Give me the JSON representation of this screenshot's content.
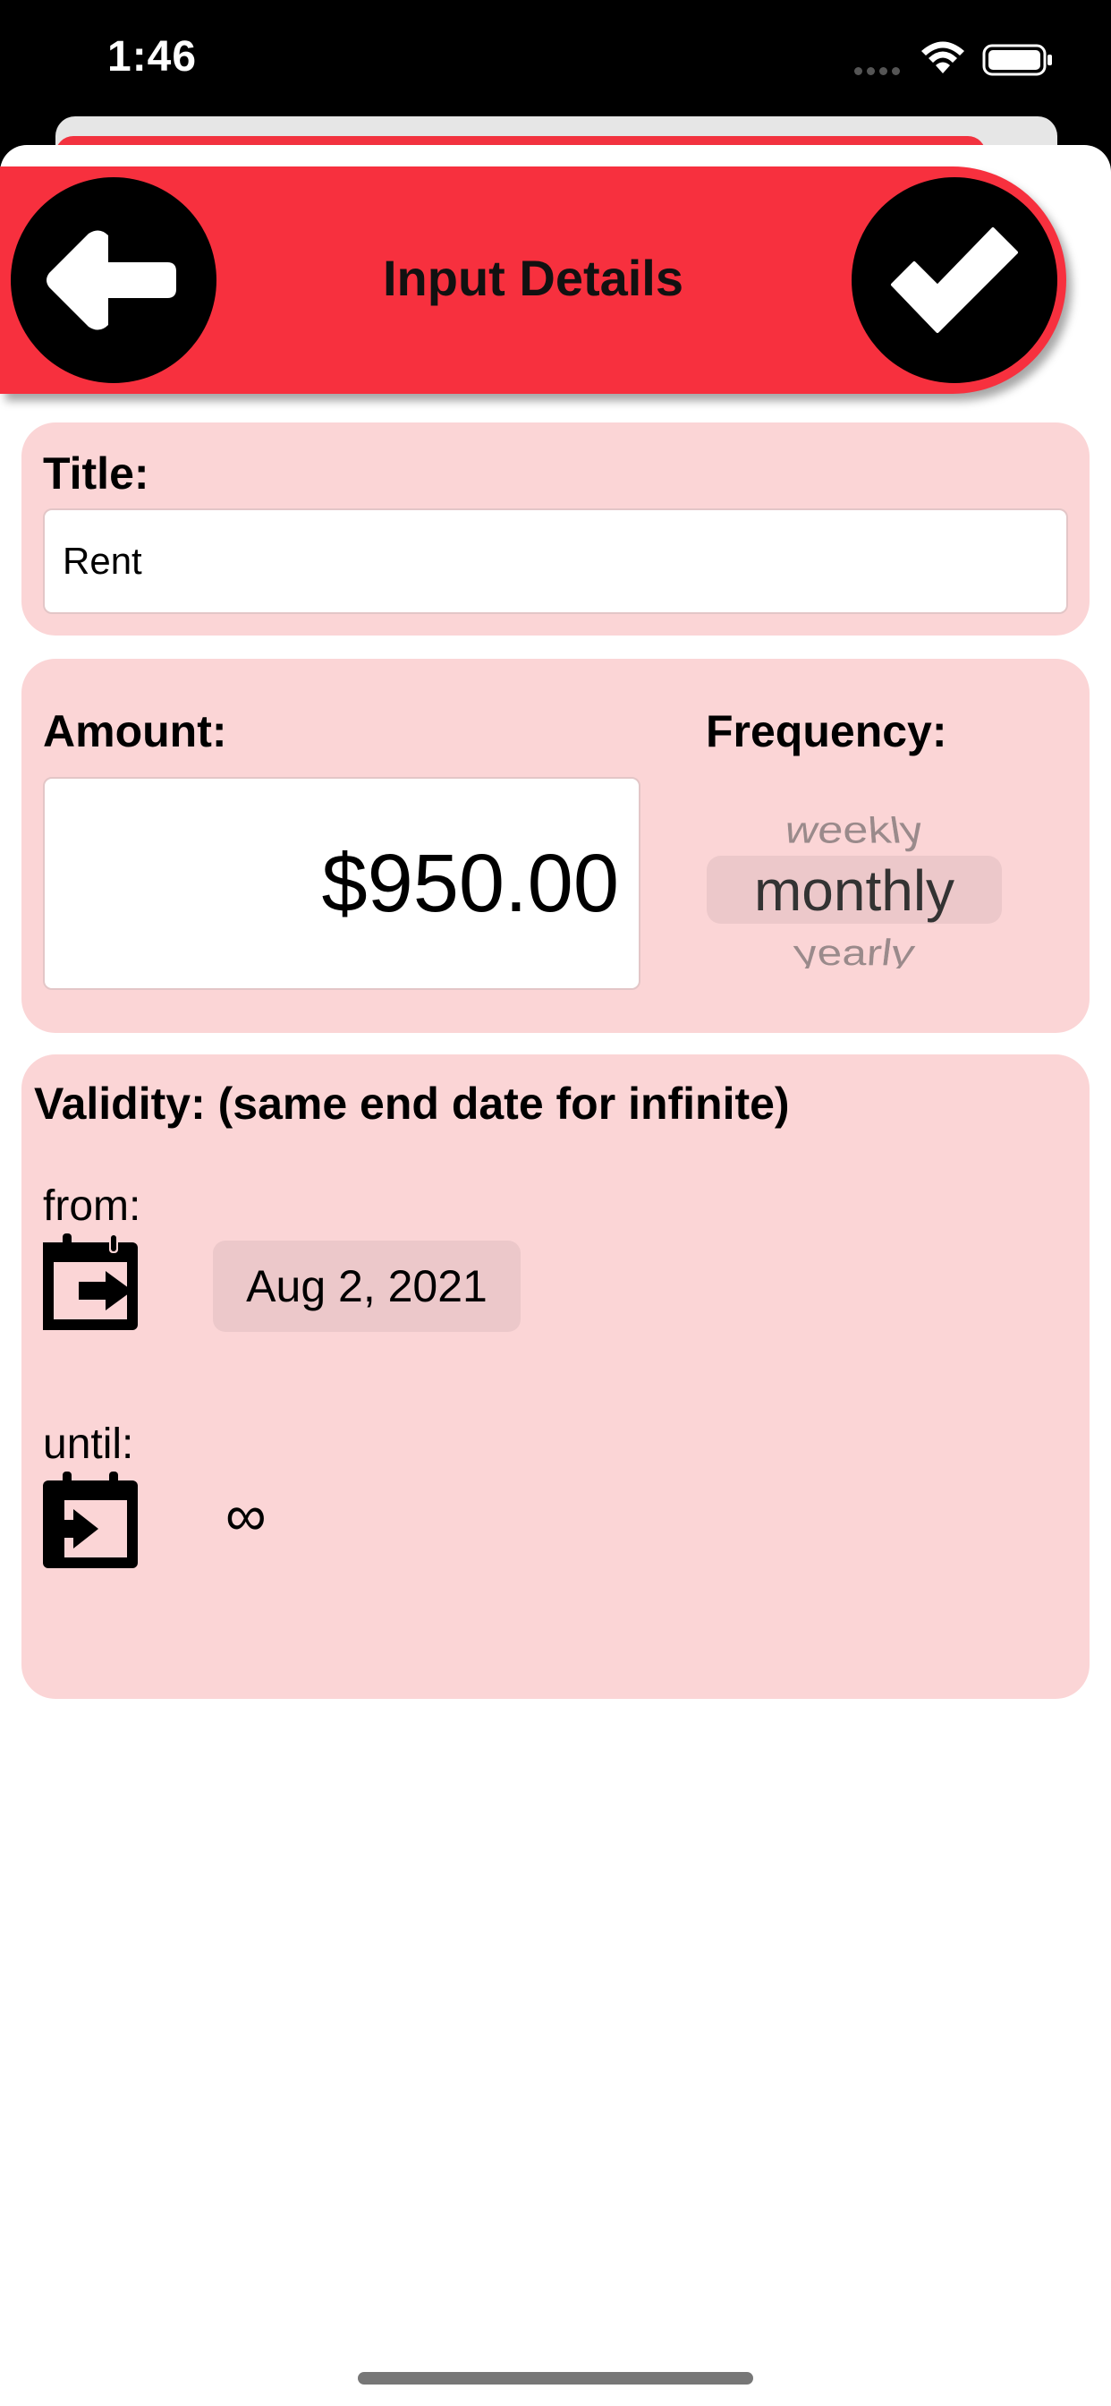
{
  "status_bar": {
    "time": "1:46"
  },
  "header": {
    "title": "Input Details"
  },
  "title_section": {
    "label": "Title:",
    "value": "Rent"
  },
  "amount_section": {
    "amount_label": "Amount:",
    "amount_value": "$950.00",
    "frequency_label": "Frequency:",
    "frequency_options": [
      "weekly",
      "monthly",
      "yearly"
    ],
    "frequency_selected": "monthly"
  },
  "validity_section": {
    "label": "Validity: (same end date for infinite)",
    "from_label": "from:",
    "from_date": "Aug 2, 2021",
    "until_label": "until:",
    "until_value": "∞"
  },
  "icons": {
    "back": "arrow-left-icon",
    "confirm": "checkmark-icon",
    "from": "calendar-export-icon",
    "until": "calendar-import-icon"
  },
  "colors": {
    "header": "#f7303e",
    "card": "#fbd5d6",
    "chip": "#ecc8ca"
  }
}
